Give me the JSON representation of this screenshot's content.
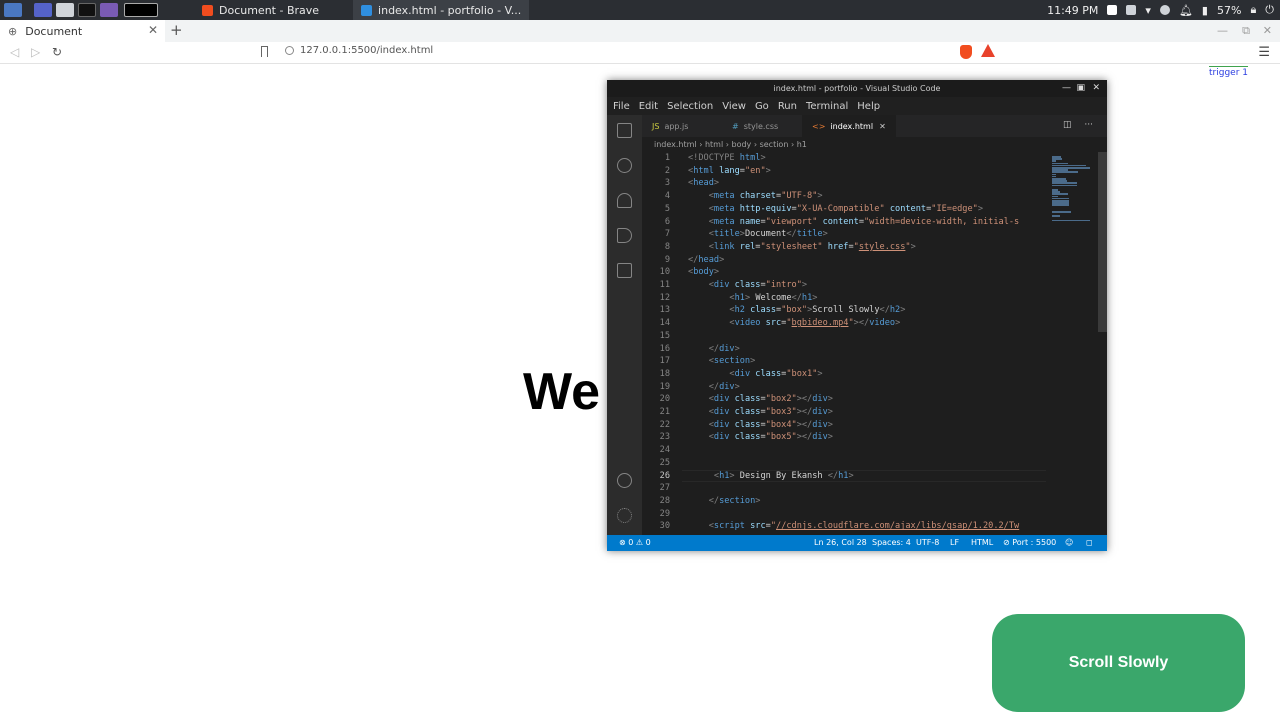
{
  "taskbar": {
    "windows": [
      {
        "label": "Document - Brave",
        "icon": "brave-icon"
      },
      {
        "label": "index.html - portfolio - V...",
        "icon": "vscode-icon"
      }
    ],
    "clock": "11:49 PM",
    "battery": "57%"
  },
  "browser": {
    "tab_title": "Document",
    "address": "127.0.0.1:5500/index.html"
  },
  "page": {
    "trigger_label": "trigger 1",
    "big_word": "We",
    "scroll_box_label": "Scroll Slowly"
  },
  "vscode": {
    "window_title": "index.html - portfolio - Visual Studio Code",
    "menu": [
      "File",
      "Edit",
      "Selection",
      "View",
      "Go",
      "Run",
      "Terminal",
      "Help"
    ],
    "tabs": [
      {
        "label": "app.js",
        "icon": "JS",
        "active": false
      },
      {
        "label": "style.css",
        "icon": "#",
        "active": false
      },
      {
        "label": "index.html",
        "icon": "<>",
        "active": true
      }
    ],
    "breadcrumb": [
      "index.html",
      "html",
      "body",
      "section",
      "h1"
    ],
    "cursor_line": 26,
    "status": {
      "problems": "⊗ 0 ⚠ 0",
      "position": "Ln 26, Col 28",
      "spaces": "Spaces: 4",
      "encoding": "UTF-8",
      "eol": "LF",
      "language": "HTML",
      "port": "⊘ Port : 5500"
    },
    "code_lines": [
      "1",
      "2",
      "3",
      "4",
      "5",
      "6",
      "7",
      "8",
      "9",
      "10",
      "11",
      "12",
      "13",
      "14",
      "15",
      "16",
      "17",
      "18",
      "19",
      "20",
      "21",
      "22",
      "23",
      "24",
      "25",
      "26",
      "27",
      "28",
      "29",
      "30"
    ],
    "code": [
      [
        [
          "pun",
          "<!DOCTYPE "
        ],
        [
          "tag",
          "html"
        ],
        [
          "pun",
          ">"
        ]
      ],
      [
        [
          "pun",
          "<"
        ],
        [
          "tag",
          "html"
        ],
        [
          "attr",
          " lang"
        ],
        [
          "txt",
          "="
        ],
        [
          "str",
          "\"en\""
        ],
        [
          "pun",
          ">"
        ]
      ],
      [
        [
          "pun",
          "<"
        ],
        [
          "tag",
          "head"
        ],
        [
          "pun",
          ">"
        ]
      ],
      [
        [
          "txt",
          "    "
        ],
        [
          "pun",
          "<"
        ],
        [
          "tag",
          "meta"
        ],
        [
          "attr",
          " charset"
        ],
        [
          "txt",
          "="
        ],
        [
          "str",
          "\"UTF-8\""
        ],
        [
          "pun",
          ">"
        ]
      ],
      [
        [
          "txt",
          "    "
        ],
        [
          "pun",
          "<"
        ],
        [
          "tag",
          "meta"
        ],
        [
          "attr",
          " http-equiv"
        ],
        [
          "txt",
          "="
        ],
        [
          "str",
          "\"X-UA-Compatible\""
        ],
        [
          "attr",
          " content"
        ],
        [
          "txt",
          "="
        ],
        [
          "str",
          "\"IE=edge\""
        ],
        [
          "pun",
          ">"
        ]
      ],
      [
        [
          "txt",
          "    "
        ],
        [
          "pun",
          "<"
        ],
        [
          "tag",
          "meta"
        ],
        [
          "attr",
          " name"
        ],
        [
          "txt",
          "="
        ],
        [
          "str",
          "\"viewport\""
        ],
        [
          "attr",
          " content"
        ],
        [
          "txt",
          "="
        ],
        [
          "str",
          "\"width=device-width, initial-s"
        ]
      ],
      [
        [
          "txt",
          "    "
        ],
        [
          "pun",
          "<"
        ],
        [
          "tag",
          "title"
        ],
        [
          "pun",
          ">"
        ],
        [
          "txt",
          "Document"
        ],
        [
          "pun",
          "</"
        ],
        [
          "tag",
          "title"
        ],
        [
          "pun",
          ">"
        ]
      ],
      [
        [
          "txt",
          "    "
        ],
        [
          "pun",
          "<"
        ],
        [
          "tag",
          "link"
        ],
        [
          "attr",
          " rel"
        ],
        [
          "txt",
          "="
        ],
        [
          "str",
          "\"stylesheet\""
        ],
        [
          "attr",
          " href"
        ],
        [
          "txt",
          "="
        ],
        [
          "str",
          "\""
        ],
        [
          "strlink",
          "style.css"
        ],
        [
          "str",
          "\""
        ],
        [
          "pun",
          ">"
        ]
      ],
      [
        [
          "pun",
          "</"
        ],
        [
          "tag",
          "head"
        ],
        [
          "pun",
          ">"
        ]
      ],
      [
        [
          "pun",
          "<"
        ],
        [
          "tag",
          "body"
        ],
        [
          "pun",
          ">"
        ]
      ],
      [
        [
          "txt",
          "    "
        ],
        [
          "pun",
          "<"
        ],
        [
          "tag",
          "div"
        ],
        [
          "attr",
          " class"
        ],
        [
          "txt",
          "="
        ],
        [
          "str",
          "\"intro\""
        ],
        [
          "pun",
          ">"
        ]
      ],
      [
        [
          "txt",
          "        "
        ],
        [
          "pun",
          "<"
        ],
        [
          "tag",
          "h1"
        ],
        [
          "pun",
          ">"
        ],
        [
          "txt",
          " Welcome"
        ],
        [
          "pun",
          "</"
        ],
        [
          "tag",
          "h1"
        ],
        [
          "pun",
          ">"
        ]
      ],
      [
        [
          "txt",
          "        "
        ],
        [
          "pun",
          "<"
        ],
        [
          "tag",
          "h2"
        ],
        [
          "attr",
          " class"
        ],
        [
          "txt",
          "="
        ],
        [
          "str",
          "\"box\""
        ],
        [
          "pun",
          ">"
        ],
        [
          "txt",
          "Scroll Slowly"
        ],
        [
          "pun",
          "</"
        ],
        [
          "tag",
          "h2"
        ],
        [
          "pun",
          ">"
        ]
      ],
      [
        [
          "txt",
          "        "
        ],
        [
          "pun",
          "<"
        ],
        [
          "tag",
          "video"
        ],
        [
          "attr",
          " src"
        ],
        [
          "txt",
          "="
        ],
        [
          "str",
          "\""
        ],
        [
          "strlink",
          "bgbideo.mp4"
        ],
        [
          "str",
          "\""
        ],
        [
          "pun",
          "></"
        ],
        [
          "tag",
          "video"
        ],
        [
          "pun",
          ">"
        ]
      ],
      [
        [
          "txt",
          ""
        ]
      ],
      [
        [
          "txt",
          "    "
        ],
        [
          "pun",
          "</"
        ],
        [
          "tag",
          "div"
        ],
        [
          "pun",
          ">"
        ]
      ],
      [
        [
          "txt",
          "    "
        ],
        [
          "pun",
          "<"
        ],
        [
          "tag",
          "section"
        ],
        [
          "pun",
          ">"
        ]
      ],
      [
        [
          "txt",
          "        "
        ],
        [
          "pun",
          "<"
        ],
        [
          "tag",
          "div"
        ],
        [
          "attr",
          " class"
        ],
        [
          "txt",
          "="
        ],
        [
          "str",
          "\"box1\""
        ],
        [
          "pun",
          ">"
        ]
      ],
      [
        [
          "txt",
          "    "
        ],
        [
          "pun",
          "</"
        ],
        [
          "tag",
          "div"
        ],
        [
          "pun",
          ">"
        ]
      ],
      [
        [
          "txt",
          "    "
        ],
        [
          "pun",
          "<"
        ],
        [
          "tag",
          "div"
        ],
        [
          "attr",
          " class"
        ],
        [
          "txt",
          "="
        ],
        [
          "str",
          "\"box2\""
        ],
        [
          "pun",
          "></"
        ],
        [
          "tag",
          "div"
        ],
        [
          "pun",
          ">"
        ]
      ],
      [
        [
          "txt",
          "    "
        ],
        [
          "pun",
          "<"
        ],
        [
          "tag",
          "div"
        ],
        [
          "attr",
          " class"
        ],
        [
          "txt",
          "="
        ],
        [
          "str",
          "\"box3\""
        ],
        [
          "pun",
          "></"
        ],
        [
          "tag",
          "div"
        ],
        [
          "pun",
          ">"
        ]
      ],
      [
        [
          "txt",
          "    "
        ],
        [
          "pun",
          "<"
        ],
        [
          "tag",
          "div"
        ],
        [
          "attr",
          " class"
        ],
        [
          "txt",
          "="
        ],
        [
          "str",
          "\"box4\""
        ],
        [
          "pun",
          "></"
        ],
        [
          "tag",
          "div"
        ],
        [
          "pun",
          ">"
        ]
      ],
      [
        [
          "txt",
          "    "
        ],
        [
          "pun",
          "<"
        ],
        [
          "tag",
          "div"
        ],
        [
          "attr",
          " class"
        ],
        [
          "txt",
          "="
        ],
        [
          "str",
          "\"box5\""
        ],
        [
          "pun",
          "></"
        ],
        [
          "tag",
          "div"
        ],
        [
          "pun",
          ">"
        ]
      ],
      [
        [
          "txt",
          ""
        ]
      ],
      [
        [
          "txt",
          ""
        ]
      ],
      [
        [
          "txt",
          "     "
        ],
        [
          "pun",
          "<"
        ],
        [
          "tag",
          "h1"
        ],
        [
          "pun",
          ">"
        ],
        [
          "txt",
          " Design By Ekansh "
        ],
        [
          "pun",
          "</"
        ],
        [
          "tag",
          "h1"
        ],
        [
          "pun",
          ">"
        ]
      ],
      [
        [
          "txt",
          ""
        ]
      ],
      [
        [
          "txt",
          "    "
        ],
        [
          "pun",
          "</"
        ],
        [
          "tag",
          "section"
        ],
        [
          "pun",
          ">"
        ]
      ],
      [
        [
          "txt",
          ""
        ]
      ],
      [
        [
          "txt",
          "    "
        ],
        [
          "pun",
          "<"
        ],
        [
          "tag",
          "script"
        ],
        [
          "attr",
          " src"
        ],
        [
          "txt",
          "="
        ],
        [
          "str",
          "\""
        ],
        [
          "strlink",
          "//cdnjs.cloudflare.com/ajax/libs/gsap/1.20.2/Tw"
        ]
      ]
    ]
  }
}
